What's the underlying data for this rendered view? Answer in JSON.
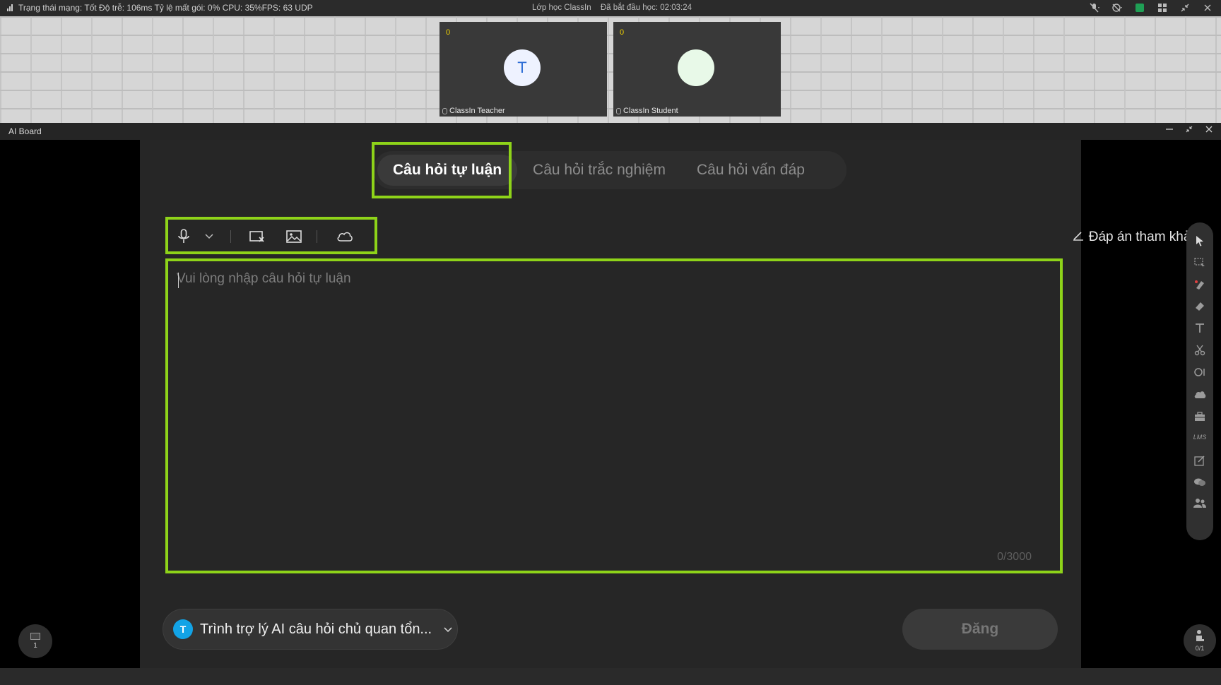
{
  "status": {
    "network": "Trạng thái mạng: Tốt Độ trễ: 106ms Tỷ lệ mất gói: 0%  CPU: 35%FPS: 63 UDP",
    "class_name": "Lớp học ClassIn",
    "elapsed": "Đã bắt đầu học: 02:03:24"
  },
  "videos": [
    {
      "count": "0",
      "initial": "T",
      "name": "ClassIn Teacher",
      "avatar_color": "#eef2ff",
      "initial_color": "#2f6fd6"
    },
    {
      "count": "0",
      "initial": "",
      "name": "ClassIn Student",
      "avatar_color": "#e8f9e8",
      "initial_color": "#2f6fd6"
    }
  ],
  "window": {
    "title": "AI Board"
  },
  "tabs": [
    {
      "label": "Câu hỏi tự luận",
      "active": true
    },
    {
      "label": "Câu hỏi trắc nghiệm",
      "active": false
    },
    {
      "label": "Câu hỏi vấn đáp",
      "active": false
    }
  ],
  "toolbar": {
    "reference_answer": "Đáp án tham khảo",
    "icons": [
      "microphone-icon",
      "chevron-down-icon",
      "screenshot-icon",
      "image-icon",
      "cloud-icon"
    ]
  },
  "editor": {
    "placeholder": "Vui lòng nhập câu hỏi tự luận",
    "value": "",
    "counter": "0/3000"
  },
  "assistant": {
    "initial": "T",
    "label": "Trình trợ lý AI câu hỏi chủ quan tổn..."
  },
  "post_button": "Đăng",
  "page_indicator": "1",
  "seat_indicator": "0/1",
  "colors": {
    "highlight": "#8ed319",
    "count": "#f1d200",
    "assistant_avatar": "#12a3e6"
  }
}
